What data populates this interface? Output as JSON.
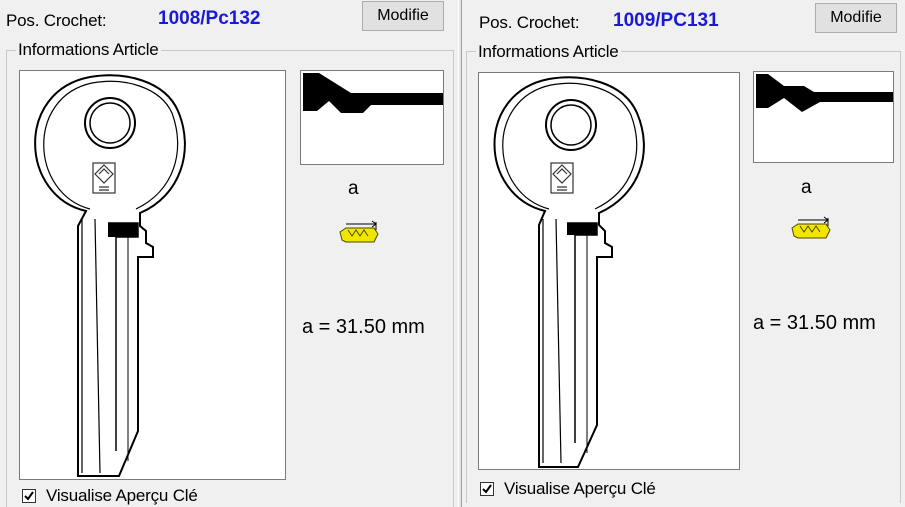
{
  "panels": [
    {
      "pos_label": "Pos. Crochet:",
      "pos_value": "1008/Pc132",
      "modifie_label": "Modifie",
      "group_title": "Informations Article",
      "cut_letter": "a",
      "measure_text": "a = 31.50 mm",
      "checkbox_label": "Visualise Aperçu Clé",
      "checkbox_checked": true
    },
    {
      "pos_label": "Pos. Crochet:",
      "pos_value": "1009/PC131",
      "modifie_label": "Modifie",
      "group_title": "Informations Article",
      "cut_letter": "a",
      "measure_text": "a = 31.50 mm",
      "checkbox_label": "Visualise Aperçu Clé",
      "checkbox_checked": true
    }
  ],
  "colors": {
    "value_blue": "#1a1ad6",
    "measure_icon_yellow": "#f2e600"
  },
  "icons": {
    "key_image": "key-blank-icon",
    "profile_image": "key-profile-icon",
    "measure": "measure-arrow-icon"
  }
}
